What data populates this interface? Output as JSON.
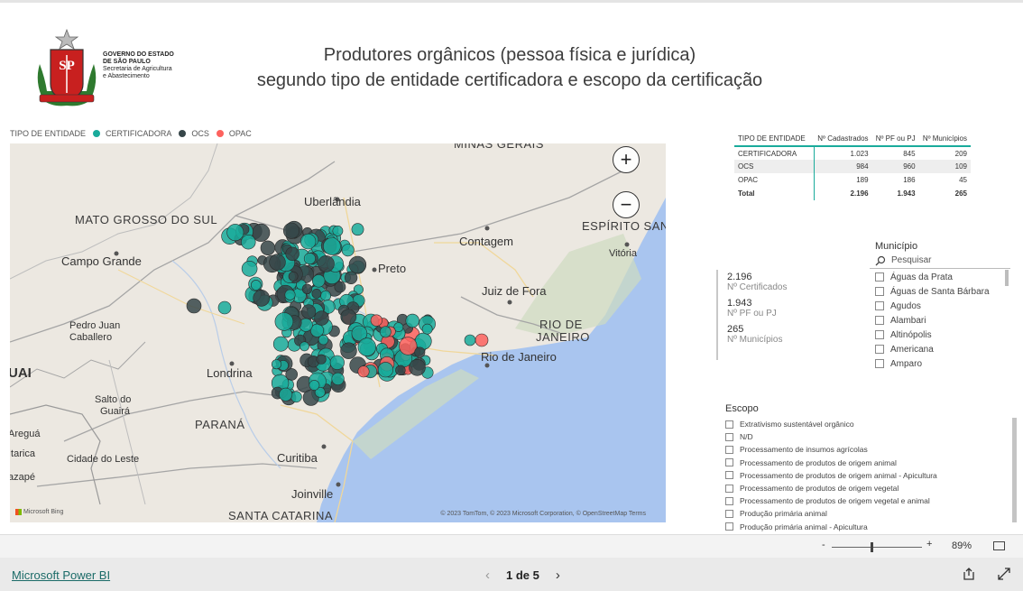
{
  "header": {
    "logo_lines": [
      "GOVERNO DO ESTADO",
      "DE SÃO PAULO",
      "Secretaria de Agricultura",
      "e Abastecimento"
    ],
    "title_line1": "Produtores orgânicos (pessoa física e jurídica)",
    "title_line2": "segundo tipo de entidade certificadora e escopo da certificação"
  },
  "legend": {
    "title": "TIPO DE ENTIDADE",
    "items": [
      {
        "label": "CERTIFICADORA",
        "color": "#1aab9b"
      },
      {
        "label": "OCS",
        "color": "#374649"
      },
      {
        "label": "OPAC",
        "color": "#fd625e"
      }
    ]
  },
  "map": {
    "labels": {
      "minas": "MINAS GERAIS",
      "mato_grosso": "MATO GROSSO DO SUL",
      "uberlandia": "Uberlândia",
      "espirito": "ESPÍRITO SANT",
      "contagem": "Contagem",
      "campo_grande": "Campo Grande",
      "vitoria": "Vitória",
      "preto": "Preto",
      "juiz": "Juiz de Fora",
      "pedro1": "Pedro Juan",
      "pedro2": "Caballero",
      "rio_state1": "RIO DE",
      "rio_state2": "JANEIRO",
      "rio": "Rio de Janeiro",
      "uai": "UAI",
      "londrina": "Londrina",
      "salto1": "Salto do",
      "salto2": "Guairá",
      "parana": "PARANÁ",
      "aregua": "Areguá",
      "itarica": "Itarica",
      "cidade": "Cidade do Leste",
      "curitiba": "Curitiba",
      "azape": "azapé",
      "joinville": "Joinville",
      "santa": "SANTA CATARINA"
    },
    "attribution": "© 2023 TomTom, © 2023 Microsoft Corporation, © OpenStreetMap  Terms",
    "bing": "Microsoft Bing",
    "zoom_in": "+",
    "zoom_out": "−"
  },
  "summary_table": {
    "headers": [
      "TIPO DE ENTIDADE",
      "Nº Cadastrados",
      "Nº PF ou PJ",
      "Nº Municípios"
    ],
    "rows": [
      [
        "CERTIFICADORA",
        "1.023",
        "845",
        "209"
      ],
      [
        "OCS",
        "984",
        "960",
        "109"
      ],
      [
        "OPAC",
        "189",
        "186",
        "45"
      ]
    ],
    "total": [
      "Total",
      "2.196",
      "1.943",
      "265"
    ]
  },
  "cards": [
    {
      "value": "2.196",
      "label": "Nº Certificados"
    },
    {
      "value": "1.943",
      "label": "Nº PF ou PJ"
    },
    {
      "value": "265",
      "label": "Nº Municípios"
    }
  ],
  "municipio_slicer": {
    "title": "Município",
    "search_placeholder": "Pesquisar",
    "items": [
      "Águas da Prata",
      "Águas de Santa Bárbara",
      "Agudos",
      "Alambari",
      "Altinópolis",
      "Americana",
      "Amparo"
    ]
  },
  "escopo_slicer": {
    "title": "Escopo",
    "items": [
      "Extrativismo sustentável orgânico",
      "N/D",
      "Processamento de insumos agrícolas",
      "Processamento de produtos de origem animal",
      "Processamento de produtos de origem animal - Apicultura",
      "Processamento de produtos de origem vegetal",
      "Processamento de produtos de origem vegetal e animal",
      "Produção primária animal",
      "Produção primária animal - Apicultura"
    ]
  },
  "zoom": {
    "minus": "-",
    "plus": "+",
    "percent": "89%"
  },
  "footer": {
    "powerbi_link": "Microsoft Power BI",
    "page_indicator": "1 de 5",
    "prev": "‹",
    "next": "›"
  }
}
